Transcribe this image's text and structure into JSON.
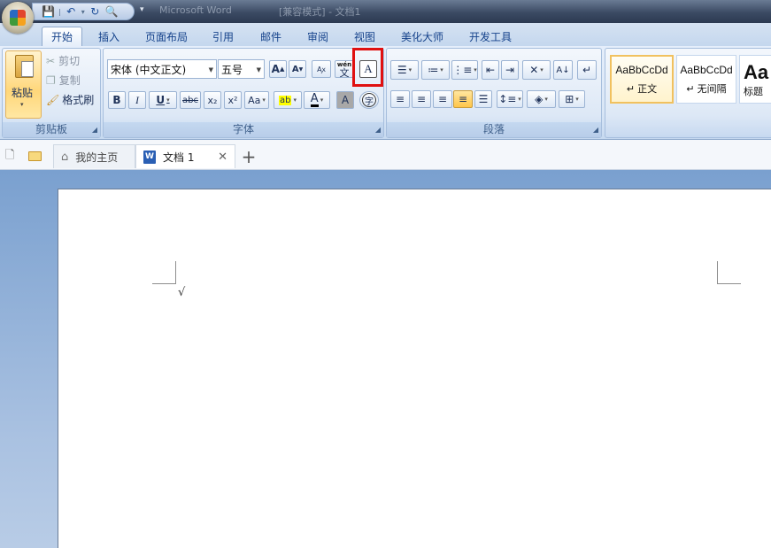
{
  "titlebar": {
    "title_blur_1": "Microsoft Word",
    "title_blur_2": "[兼容模式] - 文档1",
    "qat": {
      "save": "💾",
      "undo": "↶",
      "redo": "↻",
      "preview": "🔍",
      "customize": "▾"
    }
  },
  "tabs": [
    "开始",
    "插入",
    "页面布局",
    "引用",
    "邮件",
    "审阅",
    "视图",
    "美化大师",
    "开发工具"
  ],
  "clipboard": {
    "paste_label": "粘贴",
    "cut_label": "剪切",
    "copy_label": "复制",
    "format_painter_label": "格式刷",
    "group_label": "剪贴板"
  },
  "font": {
    "font_name": "宋体 (中文正文)",
    "font_size": "五号",
    "group_label": "字体",
    "grow_label": "A",
    "shrink_label": "A",
    "bold": "B",
    "italic": "I",
    "underline": "U",
    "strike": "abc",
    "subscript": "x₂",
    "superscript": "x²",
    "change_case": "Aa",
    "highlight": "ab",
    "font_color": "A",
    "char_shading": "A",
    "enclose": "字",
    "phonetic": "wén",
    "phonetic_char": "文",
    "char_border": "A"
  },
  "paragraph": {
    "group_label": "段落"
  },
  "styles": [
    {
      "preview": "AaBbCcDd",
      "name": "↵ 正文"
    },
    {
      "preview": "AaBbCcDd",
      "name": "↵ 无间隔"
    },
    {
      "preview": "Aa",
      "name": "标题"
    }
  ],
  "doc_tabs": {
    "home_label": "我的主页",
    "doc_label": "文档 1",
    "add_label": "+",
    "close_label": "✕",
    "word_icon_label": "W"
  },
  "document": {
    "cursor_mark": "√"
  },
  "colors": {
    "highlight_border": "#e01010",
    "ribbon_text": "#15428b"
  }
}
